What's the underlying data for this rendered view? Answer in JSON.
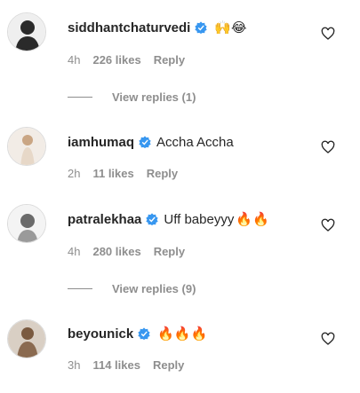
{
  "comments": [
    {
      "username": "siddhantchaturvedi",
      "text": "",
      "emojis": "🙌😂",
      "time": "4h",
      "likes": "226 likes",
      "reply": "Reply",
      "view_replies": "View replies (1)",
      "avatar_color": "#2a2a2a"
    },
    {
      "username": "iamhumaq",
      "text": "Accha Accha",
      "emojis": "",
      "time": "2h",
      "likes": "11 likes",
      "reply": "Reply",
      "avatar_color": "#d8c4b0"
    },
    {
      "username": "patralekhaa",
      "text": "Uff babeyyy",
      "emojis": "🔥🔥",
      "time": "4h",
      "likes": "280 likes",
      "reply": "Reply",
      "view_replies": "View replies (9)",
      "avatar_color": "#c9c9c9"
    },
    {
      "username": "beyounick",
      "text": "",
      "emojis": "🔥🔥🔥",
      "time": "3h",
      "likes": "114 likes",
      "reply": "Reply",
      "avatar_color": "#8a6a50"
    }
  ],
  "colors": {
    "verified": "#3897f0",
    "muted": "#8e8e8e",
    "text": "#262626"
  },
  "icons": {
    "verified": "verified-badge-icon",
    "like": "heart-outline-icon"
  }
}
